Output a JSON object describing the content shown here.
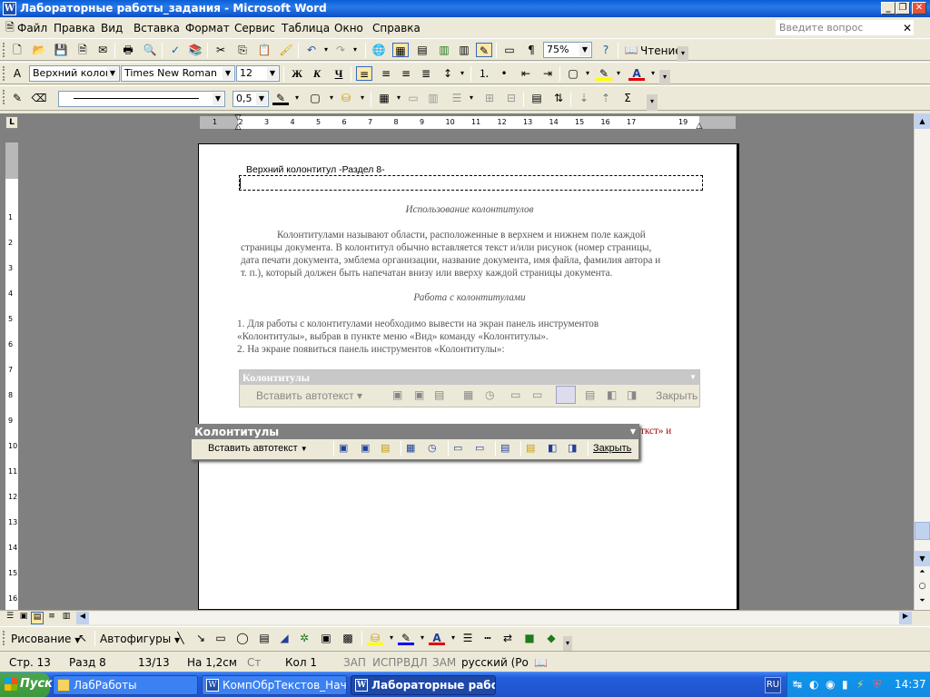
{
  "window": {
    "title": "Лабораторные работы_задания - Microsoft Word",
    "min": "_",
    "restore": "❐",
    "close": "✕"
  },
  "menu": {
    "items": [
      "Файл",
      "Правка",
      "Вид",
      "Вставка",
      "Формат",
      "Сервис",
      "Таблица",
      "Окно",
      "Справка"
    ],
    "ask_placeholder": "Введите вопрос",
    "doc_close": "✕"
  },
  "standard_toolbar": {
    "zoom": "75%",
    "reading": "Чтение"
  },
  "format_toolbar": {
    "style": "Верхний колонт",
    "font": "Times New Roman",
    "size": "12",
    "bold": "Ж",
    "italic": "К",
    "underline": "Ч"
  },
  "drawing_lines_toolbar": {
    "line_width": "0,5"
  },
  "ruler": {
    "labels": [
      "1",
      "2",
      "3",
      "4",
      "5",
      "6",
      "7",
      "8",
      "9",
      "10",
      "11",
      "12",
      "13",
      "14",
      "15",
      "16",
      "17",
      "19"
    ],
    "vlabels": [
      "1",
      "2",
      "3",
      "4",
      "5",
      "6",
      "7",
      "8",
      "9",
      "10",
      "11",
      "12",
      "13",
      "14",
      "15",
      "16"
    ]
  },
  "document": {
    "header_label": "Верхний колонтитул -Раздел 8-",
    "heading1": "Использование колонтитулов",
    "para1_l1": "Колонтитулами называют области, расположенные в верхнем и нижнем поле каждой",
    "para1_l2": "страницы документа. В колонтитул обычно вставляется текст и/или рисунок (номер страницы,",
    "para1_l3": "дата печати документа, эмблема организации, название документа, имя файла, фамилия автора и",
    "para1_l4": "т. п.), который должен быть напечатан внизу или вверху каждой страницы документа.",
    "heading2": "Работа с колонтитулами",
    "list1_l1": "1.  Для работы с колонтитулами необходимо вывести на экран панель инструментов",
    "list1_l2": "«Колонтитулы», выбрав в пункте меню «Вид» команду «Колонтитулы».",
    "list2": "2.  На экране появиться панель инструментов «Колонтитулы»:",
    "partial_text": "ткст» и"
  },
  "embedded_toolbar": {
    "title": "Колонтитулы",
    "autotext": "Вставить автотекст ▾",
    "close": "Закрыть"
  },
  "floating_toolbar": {
    "title": "Колонтитулы",
    "autotext": "Вставить автотекст",
    "close": "Закрыть"
  },
  "drawing_toolbar": {
    "draw": "Рисование",
    "autoshapes": "Автофигуры"
  },
  "statusbar": {
    "page": "Стр.  13",
    "section": "Разд  8",
    "pages": "13/13",
    "at": "На  1,2см",
    "line": "Ст",
    "col": "Кол  1",
    "rec": "ЗАП",
    "trk": "ИСПР",
    "ext": "ВДЛ",
    "ovr": "ЗАМ",
    "lang": "русский (Ро"
  },
  "taskbar": {
    "start": "Пуск",
    "tasks": [
      "ЛабРаботы",
      "КомпОбрТекстов_НачО...",
      "Лабораторные рабо..."
    ],
    "lang": "RU",
    "time": "14:37"
  }
}
